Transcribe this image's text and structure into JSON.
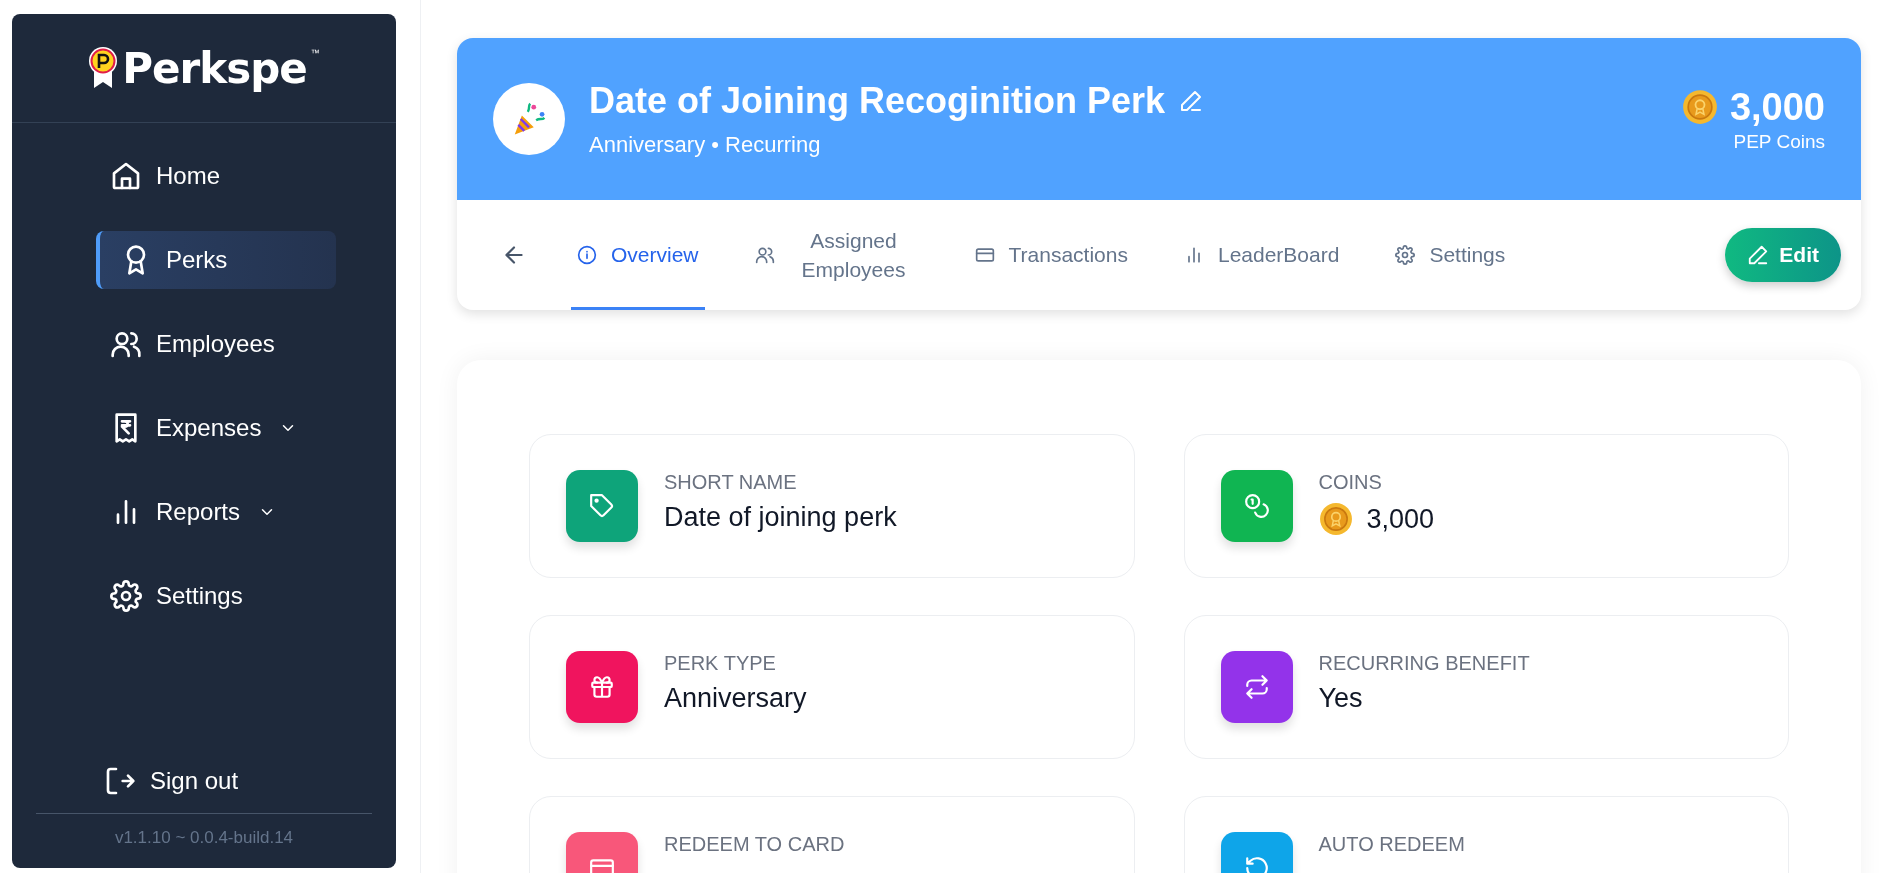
{
  "sidebar": {
    "logo": {
      "name": "Perkspe",
      "mark": "™"
    },
    "items": [
      {
        "label": "Home",
        "selected": false,
        "expandable": false
      },
      {
        "label": "Perks",
        "selected": true,
        "expandable": false
      },
      {
        "label": "Employees",
        "selected": false,
        "expandable": false
      },
      {
        "label": "Expenses",
        "selected": false,
        "expandable": true
      },
      {
        "label": "Reports",
        "selected": false,
        "expandable": true
      },
      {
        "label": "Settings",
        "selected": false,
        "expandable": false
      }
    ],
    "sign_out": "Sign out",
    "version": "v1.1.10 ~ 0.0.4-build.14"
  },
  "header": {
    "title": "Date of Joining Recoginition Perk",
    "subtitle": "Anniversary • Recurring",
    "coins": "3,000",
    "coins_label": "PEP Coins"
  },
  "tabs": [
    {
      "label": "Overview",
      "selected": true
    },
    {
      "label": "Assigned Employees",
      "selected": false
    },
    {
      "label": "Transactions",
      "selected": false
    },
    {
      "label": "LeaderBoard",
      "selected": false
    },
    {
      "label": "Settings",
      "selected": false
    }
  ],
  "edit_button": "Edit",
  "fields": [
    {
      "label": "SHORT NAME",
      "value": "Date of joining perk",
      "kind": "text",
      "color": "#0ea47a"
    },
    {
      "label": "COINS",
      "value": "3,000",
      "kind": "coins",
      "color": "#10b552"
    },
    {
      "label": "PERK TYPE",
      "value": "Anniversary",
      "kind": "text",
      "color": "#f0145e"
    },
    {
      "label": "RECURRING BENEFIT",
      "value": "Yes",
      "kind": "text",
      "color": "#9333ea"
    },
    {
      "label": "REDEEM TO CARD",
      "kind": "text",
      "color": "#f8577a"
    },
    {
      "label": "AUTO REDEEM",
      "kind": "text",
      "color": "#0ea5e9"
    }
  ]
}
